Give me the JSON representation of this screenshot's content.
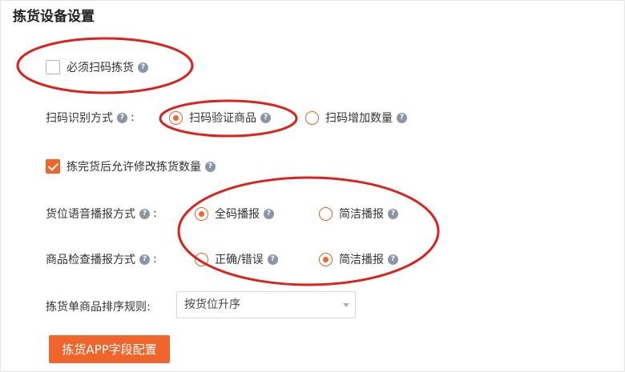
{
  "title": "拣货设备设置",
  "must_scan": {
    "label": "必须扫码拣货",
    "checked": false
  },
  "scan_mode": {
    "label": "扫码识别方式",
    "options": [
      {
        "label": "扫码验证商品",
        "selected": true
      },
      {
        "label": "扫码增加数量",
        "selected": false
      }
    ]
  },
  "allow_modify": {
    "label": "拣完货后允许修改拣货数量",
    "checked": true
  },
  "location_voice": {
    "label": "货位语音播报方式",
    "options": [
      {
        "label": "全码播报",
        "selected": true
      },
      {
        "label": "简洁播报",
        "selected": false
      }
    ]
  },
  "product_check": {
    "label": "商品检查播报方式",
    "options": [
      {
        "label": "正确/错误",
        "selected": false
      },
      {
        "label": "简洁播报",
        "selected": true
      }
    ]
  },
  "sort_rule": {
    "label": "拣货单商品排序规则:",
    "value": "按货位升序"
  },
  "app_button": {
    "label": "拣货APP字段配置"
  },
  "colors": {
    "accent": "#f0652b",
    "annotation": "#d9231d",
    "help": "#8a95a6"
  },
  "help_glyph": "?",
  "colon": ":"
}
